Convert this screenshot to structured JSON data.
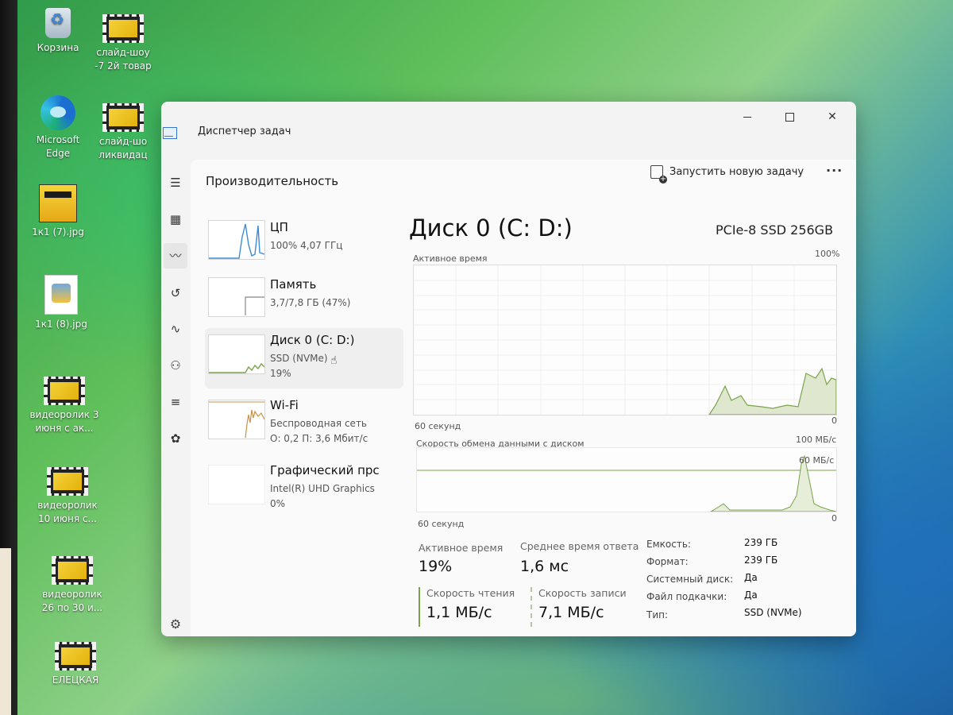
{
  "desktop": {
    "icons": [
      {
        "label": "Корзина",
        "icon": "recycle-bin-icon"
      },
      {
        "label": "слайд-шоу -7 2й товар",
        "icon": "video-file-icon"
      },
      {
        "label": "Microsoft Edge",
        "icon": "edge-browser-icon"
      },
      {
        "label": "слайд-шо ликвидац",
        "icon": "video-file-icon"
      },
      {
        "label": "1к1 (7).jpg",
        "icon": "image-file-icon"
      },
      {
        "label": "1к1 (8).jpg",
        "icon": "image-file-icon"
      },
      {
        "label": "видеоролик 3 июня с ак...",
        "icon": "video-file-icon"
      },
      {
        "label": "видеоролик 10 июня с...",
        "icon": "video-file-icon"
      },
      {
        "label": "видеоролик 26 по 30 и...",
        "icon": "video-file-icon"
      },
      {
        "label": "ЕЛЕЦКАЯ",
        "icon": "video-file-icon"
      }
    ]
  },
  "window": {
    "title": "Диспетчер задач",
    "page_title": "Производительность",
    "new_task_label": "Запустить новую задачу",
    "more_label": "...",
    "nav_icons": [
      "menu-icon",
      "processes-icon",
      "performance-icon",
      "app-history-icon",
      "startup-icon",
      "users-icon",
      "details-icon",
      "services-icon"
    ],
    "settings_icon": "gear-icon",
    "active_nav": "performance"
  },
  "resources": [
    {
      "name": "ЦП",
      "line1": "100% 4,07 ГГц",
      "line2": ""
    },
    {
      "name": "Память",
      "line1": "3,7/7,8 ГБ (47%)",
      "line2": ""
    },
    {
      "name": "Диск 0 (C: D:)",
      "line1": "SSD (NVMe)",
      "line2": "19%"
    },
    {
      "name": "Wi-Fi",
      "line1": "Беспроводная сеть",
      "line2": "О: 0,2 П: 3,6 Мбит/с"
    },
    {
      "name": "Графический прс",
      "line1": "Intel(R) UHD Graphics",
      "line2": "0%"
    }
  ],
  "detail": {
    "title": "Диск 0 (C: D:)",
    "model": "PCIe-8 SSD 256GB",
    "graph1": {
      "label": "Активное время",
      "max": "100%",
      "min": "0",
      "time": "60 секунд"
    },
    "graph2": {
      "label": "Скорость обмена данными с диском",
      "max": "100 МБ/с",
      "mid": "60 МБ/с",
      "min": "0",
      "time": "60 секунд"
    },
    "stats": {
      "active_time_label": "Активное время",
      "active_time": "19%",
      "response_label": "Среднее время ответа",
      "response": "1,6 мс",
      "read_label": "Скорость чтения",
      "read": "1,1 МБ/с",
      "write_label": "Скорость записи",
      "write": "7,1 МБ/с"
    },
    "props": [
      {
        "label": "Емкость:",
        "value": "239 ГБ"
      },
      {
        "label": "Формат:",
        "value": "239 ГБ"
      },
      {
        "label": "Системный диск:",
        "value": "Да"
      },
      {
        "label": "Файл подкачки:",
        "value": "Да"
      },
      {
        "label": "Тип:",
        "value": "SSD (NVMe)"
      }
    ]
  },
  "colors": {
    "disk_graph": "#7aa44a",
    "cpu_graph": "#3d8bd4",
    "wifi_graph": "#c8924a",
    "accent": "#3d6fd0"
  }
}
